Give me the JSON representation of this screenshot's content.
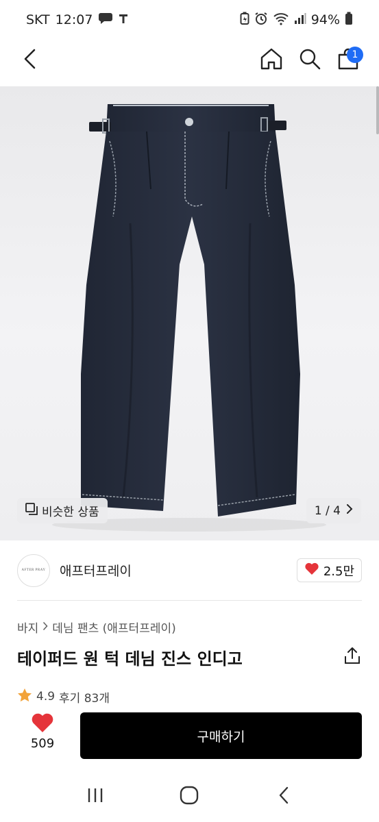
{
  "status": {
    "carrier": "SKT",
    "time": "12:07",
    "battery": "94%",
    "icons": [
      "chat-bubble-icon",
      "t-app-icon",
      "battery-saver-icon",
      "alarm-icon",
      "wifi-icon",
      "signal-icon",
      "battery-icon"
    ]
  },
  "header": {
    "icons": [
      "back-arrow-icon",
      "home-icon",
      "search-icon",
      "cart-icon"
    ],
    "cart_count": "1"
  },
  "gallery": {
    "similar_label": "비슷한 상품",
    "pager": "1 / 4"
  },
  "brand": {
    "logo_text": "AFTER PRAY",
    "name": "애프터프레이",
    "likes": "2.5만"
  },
  "product": {
    "breadcrumb": [
      "바지",
      "데님 팬츠 (애프터프레이)"
    ],
    "title": "테이퍼드 원 턱 데님 진스 인디고",
    "rating": "4.9",
    "review_label": "후기 83개"
  },
  "purchase": {
    "wish_count": "509",
    "buy_label": "구매하기"
  },
  "colors": {
    "badge": "#1f6cf5",
    "heart": "#e5343a",
    "star": "#f2a33a",
    "buy_button": "#000000"
  }
}
